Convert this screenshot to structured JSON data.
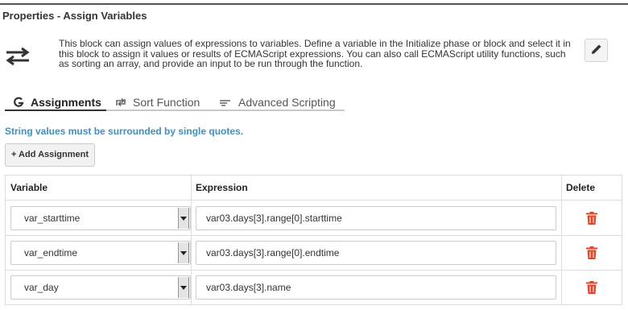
{
  "panel": {
    "title": "Properties - Assign Variables"
  },
  "description": "This block can assign values of expressions to variables. Define a variable in the Initialize phase or block and select it in this block to assign it values or results of ECMAScript expressions. You can also call ECMAScript utility functions, such as sorting an array, and provide an input to be run through the function.",
  "tabs": [
    {
      "label": "Assignments",
      "icon": "assignments-icon",
      "active": true
    },
    {
      "label": "Sort Function",
      "icon": "sort-icon",
      "active": false
    },
    {
      "label": "Advanced Scripting",
      "icon": "scripting-icon",
      "active": false
    }
  ],
  "hint": "String values must be surrounded by single quotes.",
  "add_button": "+ Add Assignment",
  "table": {
    "headers": {
      "variable": "Variable",
      "expression": "Expression",
      "delete": "Delete"
    },
    "rows": [
      {
        "variable": "var_starttime",
        "expression": "var03.days[3].range[0].starttime"
      },
      {
        "variable": "var_endtime",
        "expression": "var03.days[3].range[0].endtime"
      },
      {
        "variable": "var_day",
        "expression": "var03.days[3].name"
      }
    ]
  },
  "colors": {
    "accent": "#3d8fc9",
    "delete": "#e0482e"
  }
}
